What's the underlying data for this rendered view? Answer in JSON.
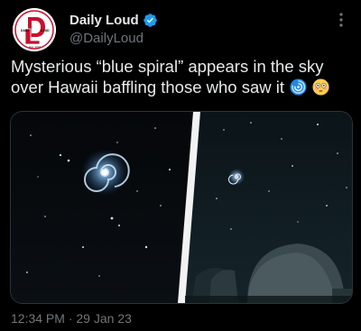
{
  "account": {
    "display_name": "Daily Loud",
    "handle": "@DailyLoud",
    "verified": true,
    "avatar_text": {
      "top_left": "DAILY",
      "top_right": "LOUD",
      "bottom": "Est. 2016"
    }
  },
  "tweet": {
    "text": "Mysterious “blue spiral” appears in the sky over Hawaii baffling those who saw it",
    "emojis": [
      "cyclone-emoji",
      "flushed-face-emoji"
    ],
    "media_alt": "blue spiral in night sky over observatory domes",
    "timestamp": "12:34 PM · 29 Jan 23"
  },
  "colors": {
    "background": "#000000",
    "text_primary": "#e7e9ea",
    "text_secondary": "#71767b",
    "verified_blue": "#1d9bf0",
    "avatar_red": "#c8102e"
  }
}
